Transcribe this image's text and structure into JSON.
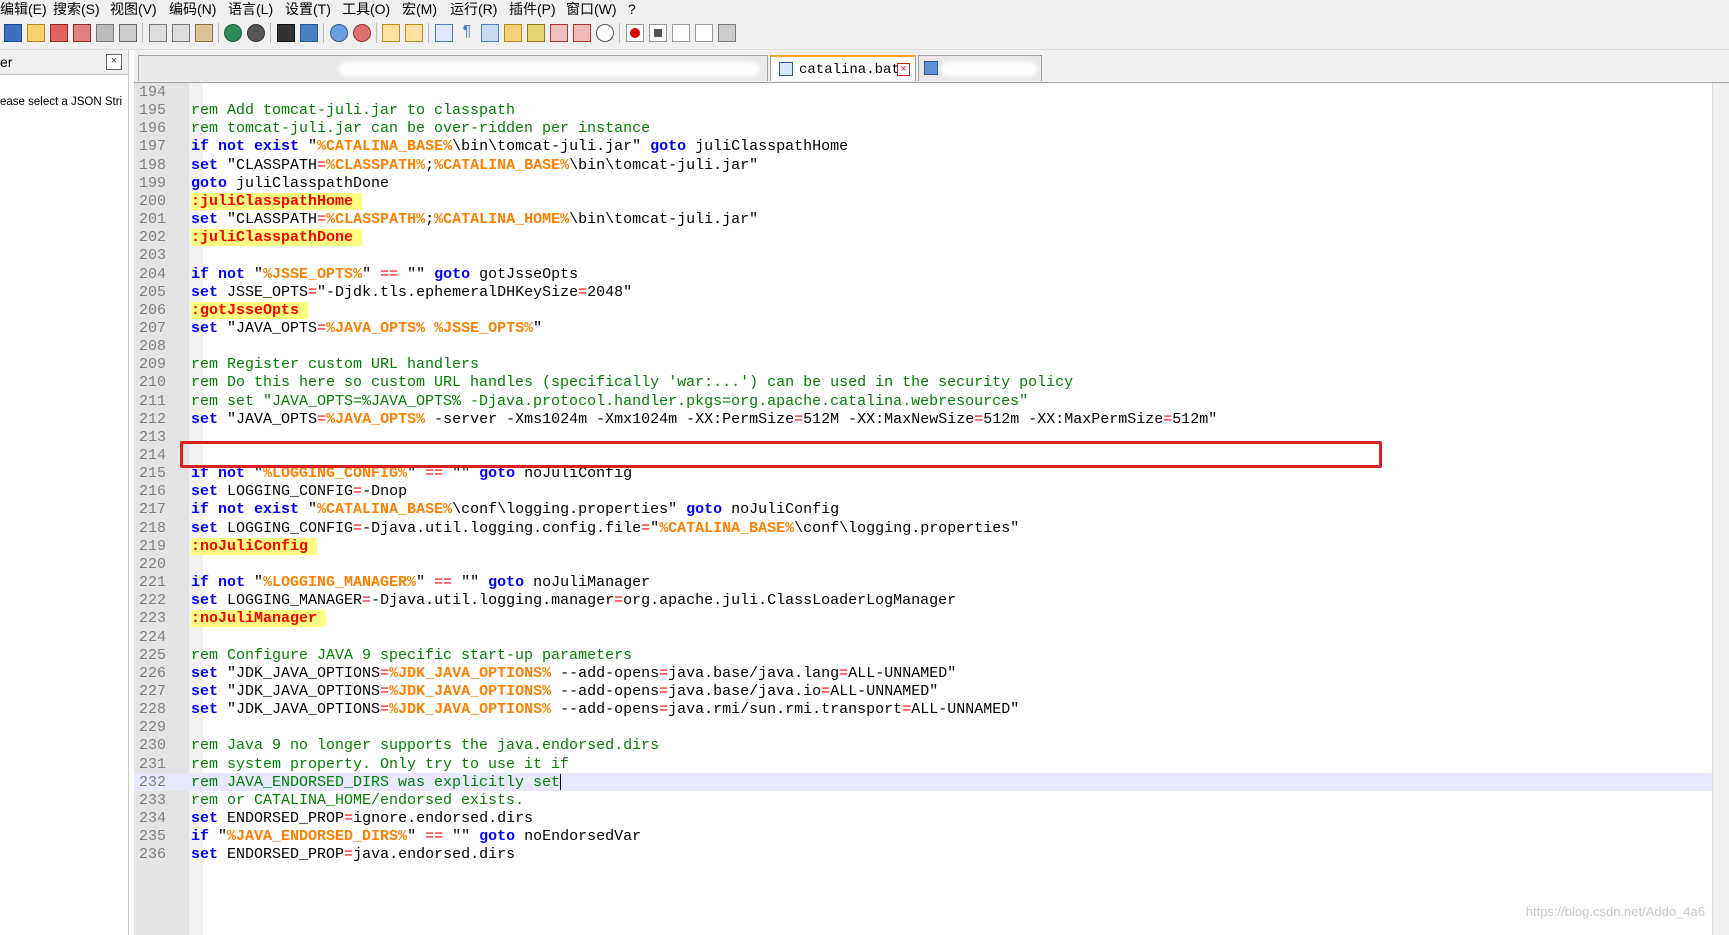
{
  "menu": [
    "编辑(E)",
    "搜索(S)",
    "视图(V)",
    "编码(N)",
    "语言(L)",
    "设置(T)",
    "工具(O)",
    "宏(M)",
    "运行(R)",
    "插件(P)",
    "窗口(W)",
    "?"
  ],
  "left_panel": {
    "title": "er",
    "close": "×",
    "hint": "ease select a JSON Stri"
  },
  "tabs": {
    "active_label": "catalina.bat",
    "close": "×"
  },
  "colors": {
    "keyword": "#0000ff",
    "comment": "#008000",
    "variable": "#ff8000",
    "operator": "#ff0000",
    "label_bg": "#ffff80",
    "highlight_box": "#d82020"
  },
  "editor": {
    "current_line": 232,
    "lines": [
      {
        "n": "194",
        "tokens": []
      },
      {
        "n": "195",
        "tokens": [
          {
            "t": "cmt",
            "v": "rem Add tomcat-juli.jar to classpath"
          }
        ]
      },
      {
        "n": "196",
        "tokens": [
          {
            "t": "cmt",
            "v": "rem tomcat-juli.jar can be over-ridden per instance"
          }
        ]
      },
      {
        "n": "197",
        "tokens": [
          {
            "t": "kw",
            "v": "if not exist"
          },
          {
            "t": "txt",
            "v": " \""
          },
          {
            "t": "var",
            "v": "%CATALINA_BASE%"
          },
          {
            "t": "txt",
            "v": "\\bin\\tomcat-juli.jar\" "
          },
          {
            "t": "kw",
            "v": "goto"
          },
          {
            "t": "txt",
            "v": " juliClasspathHome"
          }
        ]
      },
      {
        "n": "198",
        "tokens": [
          {
            "t": "kw",
            "v": "set"
          },
          {
            "t": "txt",
            "v": " \"CLASSPATH"
          },
          {
            "t": "op",
            "v": "="
          },
          {
            "t": "var",
            "v": "%CLASSPATH%"
          },
          {
            "t": "txt",
            "v": ";"
          },
          {
            "t": "var",
            "v": "%CATALINA_BASE%"
          },
          {
            "t": "txt",
            "v": "\\bin\\tomcat-juli.jar\""
          }
        ]
      },
      {
        "n": "199",
        "tokens": [
          {
            "t": "kw",
            "v": "goto"
          },
          {
            "t": "txt",
            "v": " juliClasspathDone"
          }
        ]
      },
      {
        "n": "200",
        "tokens": [
          {
            "t": "lbl",
            "v": ":juliClasspathHome "
          }
        ]
      },
      {
        "n": "201",
        "tokens": [
          {
            "t": "kw",
            "v": "set"
          },
          {
            "t": "txt",
            "v": " \"CLASSPATH"
          },
          {
            "t": "op",
            "v": "="
          },
          {
            "t": "var",
            "v": "%CLASSPATH%"
          },
          {
            "t": "txt",
            "v": ";"
          },
          {
            "t": "var",
            "v": "%CATALINA_HOME%"
          },
          {
            "t": "txt",
            "v": "\\bin\\tomcat-juli.jar\""
          }
        ]
      },
      {
        "n": "202",
        "tokens": [
          {
            "t": "lbl",
            "v": ":juliClasspathDone "
          }
        ]
      },
      {
        "n": "203",
        "tokens": []
      },
      {
        "n": "204",
        "tokens": [
          {
            "t": "kw",
            "v": "if not"
          },
          {
            "t": "txt",
            "v": " \""
          },
          {
            "t": "var",
            "v": "%JSSE_OPTS%"
          },
          {
            "t": "txt",
            "v": "\" "
          },
          {
            "t": "op",
            "v": "=="
          },
          {
            "t": "txt",
            "v": " \"\" "
          },
          {
            "t": "kw",
            "v": "goto"
          },
          {
            "t": "txt",
            "v": " gotJsseOpts"
          }
        ]
      },
      {
        "n": "205",
        "tokens": [
          {
            "t": "kw",
            "v": "set"
          },
          {
            "t": "txt",
            "v": " JSSE_OPTS"
          },
          {
            "t": "op",
            "v": "="
          },
          {
            "t": "txt",
            "v": "\"-Djdk.tls.ephemeralDHKeySize"
          },
          {
            "t": "op",
            "v": "="
          },
          {
            "t": "txt",
            "v": "2048\""
          }
        ]
      },
      {
        "n": "206",
        "tokens": [
          {
            "t": "lbl",
            "v": ":gotJsseOpts "
          }
        ]
      },
      {
        "n": "207",
        "tokens": [
          {
            "t": "kw",
            "v": "set"
          },
          {
            "t": "txt",
            "v": " \"JAVA_OPTS"
          },
          {
            "t": "op",
            "v": "="
          },
          {
            "t": "var",
            "v": "%JAVA_OPTS%"
          },
          {
            "t": "txt",
            "v": " "
          },
          {
            "t": "var",
            "v": "%JSSE_OPTS%"
          },
          {
            "t": "txt",
            "v": "\""
          }
        ]
      },
      {
        "n": "208",
        "tokens": []
      },
      {
        "n": "209",
        "tokens": [
          {
            "t": "cmt",
            "v": "rem Register custom URL handlers"
          }
        ]
      },
      {
        "n": "210",
        "tokens": [
          {
            "t": "cmt",
            "v": "rem Do this here so custom URL handles (specifically 'war:...') can be used in the security policy"
          }
        ]
      },
      {
        "n": "211",
        "tokens": [
          {
            "t": "cmt",
            "v": "rem set \"JAVA_OPTS=%JAVA_OPTS% -Djava.protocol.handler.pkgs=org.apache.catalina.webresources\""
          }
        ]
      },
      {
        "n": "212",
        "tokens": [
          {
            "t": "kw",
            "v": "set"
          },
          {
            "t": "txt",
            "v": " \"JAVA_OPTS"
          },
          {
            "t": "op",
            "v": "="
          },
          {
            "t": "var",
            "v": "%JAVA_OPTS%"
          },
          {
            "t": "txt",
            "v": " -server -Xms1024m -Xmx1024m -XX:PermSize"
          },
          {
            "t": "op",
            "v": "="
          },
          {
            "t": "txt",
            "v": "512M -XX:MaxNewSize"
          },
          {
            "t": "op",
            "v": "="
          },
          {
            "t": "txt",
            "v": "512m -XX:MaxPermSize"
          },
          {
            "t": "op",
            "v": "="
          },
          {
            "t": "txt",
            "v": "512m\""
          }
        ]
      },
      {
        "n": "213",
        "tokens": []
      },
      {
        "n": "214",
        "tokens": []
      },
      {
        "n": "215",
        "tokens": [
          {
            "t": "kw",
            "v": "if not"
          },
          {
            "t": "txt",
            "v": " \""
          },
          {
            "t": "var",
            "v": "%LOGGING_CONFIG%"
          },
          {
            "t": "txt",
            "v": "\" "
          },
          {
            "t": "op",
            "v": "=="
          },
          {
            "t": "txt",
            "v": " \"\" "
          },
          {
            "t": "kw",
            "v": "goto"
          },
          {
            "t": "txt",
            "v": " noJuliConfig"
          }
        ]
      },
      {
        "n": "216",
        "tokens": [
          {
            "t": "kw",
            "v": "set"
          },
          {
            "t": "txt",
            "v": " LOGGING_CONFIG"
          },
          {
            "t": "op",
            "v": "="
          },
          {
            "t": "txt",
            "v": "-Dnop"
          }
        ]
      },
      {
        "n": "217",
        "tokens": [
          {
            "t": "kw",
            "v": "if not exist"
          },
          {
            "t": "txt",
            "v": " \""
          },
          {
            "t": "var",
            "v": "%CATALINA_BASE%"
          },
          {
            "t": "txt",
            "v": "\\conf\\logging.properties\" "
          },
          {
            "t": "kw",
            "v": "goto"
          },
          {
            "t": "txt",
            "v": " noJuliConfig"
          }
        ]
      },
      {
        "n": "218",
        "tokens": [
          {
            "t": "kw",
            "v": "set"
          },
          {
            "t": "txt",
            "v": " LOGGING_CONFIG"
          },
          {
            "t": "op",
            "v": "="
          },
          {
            "t": "txt",
            "v": "-Djava.util.logging.config.file"
          },
          {
            "t": "op",
            "v": "="
          },
          {
            "t": "txt",
            "v": "\""
          },
          {
            "t": "var",
            "v": "%CATALINA_BASE%"
          },
          {
            "t": "txt",
            "v": "\\conf\\logging.properties\""
          }
        ]
      },
      {
        "n": "219",
        "tokens": [
          {
            "t": "lbl",
            "v": ":noJuliConfig "
          }
        ]
      },
      {
        "n": "220",
        "tokens": []
      },
      {
        "n": "221",
        "tokens": [
          {
            "t": "kw",
            "v": "if not"
          },
          {
            "t": "txt",
            "v": " \""
          },
          {
            "t": "var",
            "v": "%LOGGING_MANAGER%"
          },
          {
            "t": "txt",
            "v": "\" "
          },
          {
            "t": "op",
            "v": "=="
          },
          {
            "t": "txt",
            "v": " \"\" "
          },
          {
            "t": "kw",
            "v": "goto"
          },
          {
            "t": "txt",
            "v": " noJuliManager"
          }
        ]
      },
      {
        "n": "222",
        "tokens": [
          {
            "t": "kw",
            "v": "set"
          },
          {
            "t": "txt",
            "v": " LOGGING_MANAGER"
          },
          {
            "t": "op",
            "v": "="
          },
          {
            "t": "txt",
            "v": "-Djava.util.logging.manager"
          },
          {
            "t": "op",
            "v": "="
          },
          {
            "t": "txt",
            "v": "org.apache.juli.ClassLoaderLogManager"
          }
        ]
      },
      {
        "n": "223",
        "tokens": [
          {
            "t": "lbl",
            "v": ":noJuliManager "
          }
        ]
      },
      {
        "n": "224",
        "tokens": []
      },
      {
        "n": "225",
        "tokens": [
          {
            "t": "cmt",
            "v": "rem Configure JAVA 9 specific start-up parameters"
          }
        ]
      },
      {
        "n": "226",
        "tokens": [
          {
            "t": "kw",
            "v": "set"
          },
          {
            "t": "txt",
            "v": " \"JDK_JAVA_OPTIONS"
          },
          {
            "t": "op",
            "v": "="
          },
          {
            "t": "var",
            "v": "%JDK_JAVA_OPTIONS%"
          },
          {
            "t": "txt",
            "v": " --add-opens"
          },
          {
            "t": "op",
            "v": "="
          },
          {
            "t": "txt",
            "v": "java.base/java.lang"
          },
          {
            "t": "op",
            "v": "="
          },
          {
            "t": "txt",
            "v": "ALL-UNNAMED\""
          }
        ]
      },
      {
        "n": "227",
        "tokens": [
          {
            "t": "kw",
            "v": "set"
          },
          {
            "t": "txt",
            "v": " \"JDK_JAVA_OPTIONS"
          },
          {
            "t": "op",
            "v": "="
          },
          {
            "t": "var",
            "v": "%JDK_JAVA_OPTIONS%"
          },
          {
            "t": "txt",
            "v": " --add-opens"
          },
          {
            "t": "op",
            "v": "="
          },
          {
            "t": "txt",
            "v": "java.base/java.io"
          },
          {
            "t": "op",
            "v": "="
          },
          {
            "t": "txt",
            "v": "ALL-UNNAMED\""
          }
        ]
      },
      {
        "n": "228",
        "tokens": [
          {
            "t": "kw",
            "v": "set"
          },
          {
            "t": "txt",
            "v": " \"JDK_JAVA_OPTIONS"
          },
          {
            "t": "op",
            "v": "="
          },
          {
            "t": "var",
            "v": "%JDK_JAVA_OPTIONS%"
          },
          {
            "t": "txt",
            "v": " --add-opens"
          },
          {
            "t": "op",
            "v": "="
          },
          {
            "t": "txt",
            "v": "java.rmi/sun.rmi.transport"
          },
          {
            "t": "op",
            "v": "="
          },
          {
            "t": "txt",
            "v": "ALL-UNNAMED\""
          }
        ]
      },
      {
        "n": "229",
        "tokens": []
      },
      {
        "n": "230",
        "tokens": [
          {
            "t": "cmt",
            "v": "rem Java 9 no longer supports the java.endorsed.dirs"
          }
        ]
      },
      {
        "n": "231",
        "tokens": [
          {
            "t": "cmt",
            "v": "rem system property. Only try to use it if"
          }
        ]
      },
      {
        "n": "232",
        "tokens": [
          {
            "t": "cmt",
            "v": "rem JAVA_ENDORSED_DIRS was explicitly set"
          }
        ]
      },
      {
        "n": "233",
        "tokens": [
          {
            "t": "cmt",
            "v": "rem or CATALINA_HOME/endorsed exists."
          }
        ]
      },
      {
        "n": "234",
        "tokens": [
          {
            "t": "kw",
            "v": "set"
          },
          {
            "t": "txt",
            "v": " ENDORSED_PROP"
          },
          {
            "t": "op",
            "v": "="
          },
          {
            "t": "txt",
            "v": "ignore.endorsed.dirs"
          }
        ]
      },
      {
        "n": "235",
        "tokens": [
          {
            "t": "kw",
            "v": "if"
          },
          {
            "t": "txt",
            "v": " \""
          },
          {
            "t": "var",
            "v": "%JAVA_ENDORSED_DIRS%"
          },
          {
            "t": "txt",
            "v": "\" "
          },
          {
            "t": "op",
            "v": "=="
          },
          {
            "t": "txt",
            "v": " \"\" "
          },
          {
            "t": "kw",
            "v": "goto"
          },
          {
            "t": "txt",
            "v": " noEndorsedVar"
          }
        ]
      },
      {
        "n": "236",
        "tokens": [
          {
            "t": "kw",
            "v": "set"
          },
          {
            "t": "txt",
            "v": " ENDORSED_PROP"
          },
          {
            "t": "op",
            "v": "="
          },
          {
            "t": "txt",
            "v": "java.endorsed.dirs"
          }
        ]
      }
    ]
  },
  "watermark": "https://blog.csdn.net/Addo_4a6"
}
